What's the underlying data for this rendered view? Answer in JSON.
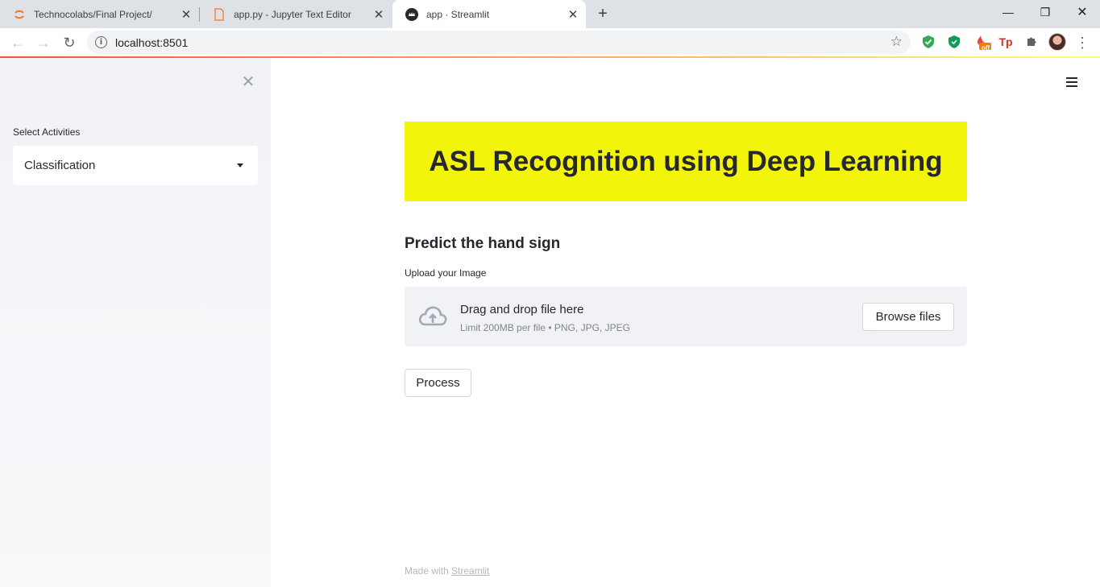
{
  "browser": {
    "tabs": [
      {
        "title": "Technocolabs/Final Project/",
        "active": false
      },
      {
        "title": "app.py - Jupyter Text Editor",
        "active": false
      },
      {
        "title": "app · Streamlit",
        "active": true
      }
    ],
    "url": "localhost:8501",
    "extension_badge": "off",
    "extension_tp": "Tp"
  },
  "sidebar": {
    "select_label": "Select Activities",
    "select_value": "Classification"
  },
  "main": {
    "banner_title": "ASL Recognition using Deep Learning",
    "banner_color": "#f2f50a",
    "subheader": "Predict the hand sign",
    "uploader": {
      "label": "Upload your Image",
      "title": "Drag and drop file here",
      "limit": "Limit 200MB per file • PNG, JPG, JPEG",
      "browse_label": "Browse files"
    },
    "process_label": "Process"
  },
  "footer": {
    "prefix": "Made with ",
    "link": "Streamlit"
  }
}
